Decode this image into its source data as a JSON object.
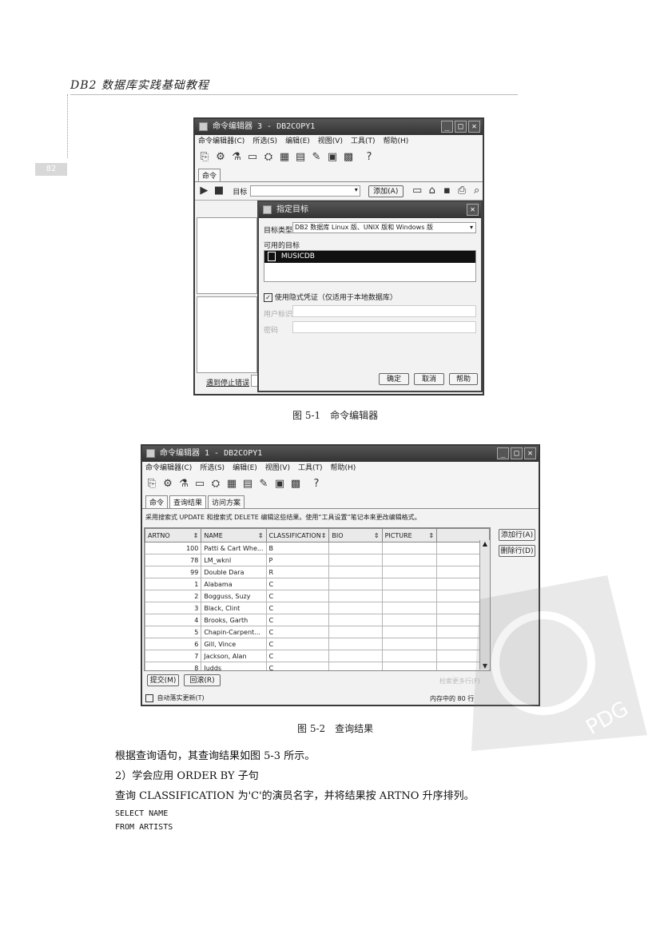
{
  "page": {
    "header": "DB2 数据库实践基础教程",
    "page_number": "82"
  },
  "fig1": {
    "window_title": "命令编辑器 3 - DB2COPY1",
    "menu": [
      "命令编辑器(C)",
      "所选(S)",
      "编辑(E)",
      "视图(V)",
      "工具(T)",
      "帮助(H)"
    ],
    "tab": "命令",
    "target_label": "目标",
    "add_button": "添加(A)",
    "left_button": "遇到停止错误",
    "dialog": {
      "title": "指定目标",
      "target_type_label": "目标类型",
      "target_type_value": "DB2 数据库 Linux 版、UNIX 版和 Windows 版",
      "available_label": "可用的目标",
      "selected_target": "MUSICDB",
      "implicit_check_label": "使用隐式凭证（仅适用于本地数据库）",
      "user_label": "用户标识",
      "password_label": "密码",
      "ok": "确定",
      "cancel": "取消",
      "help": "帮助"
    },
    "caption": "图 5-1　命令编辑器"
  },
  "fig2": {
    "window_title": "命令编辑器 1 - DB2COPY1",
    "menu": [
      "命令编辑器(C)",
      "所选(S)",
      "编辑(E)",
      "视图(V)",
      "工具(T)",
      "帮助(H)"
    ],
    "tabs": [
      "命令",
      "查询结果",
      "访问方案"
    ],
    "info": "采用搜索式 UPDATE 和搜索式 DELETE 编辑这些结果。使用“工具设置”笔记本来更改编辑格式。",
    "columns": [
      "ARTNO",
      "NAME",
      "CLASSIFICATION",
      "BIO",
      "PICTURE"
    ],
    "rows": [
      [
        "100",
        "Patti & Cart Whe...",
        "B",
        "",
        ""
      ],
      [
        "78",
        "LM_wknl",
        "P",
        "",
        ""
      ],
      [
        "99",
        "Double Dara",
        "R",
        "",
        ""
      ],
      [
        "1",
        "Alabama",
        "C",
        "",
        ""
      ],
      [
        "2",
        "Bogguss, Suzy",
        "C",
        "",
        ""
      ],
      [
        "3",
        "Black, Clint",
        "C",
        "",
        ""
      ],
      [
        "4",
        "Brooks, Garth",
        "C",
        "",
        ""
      ],
      [
        "5",
        "Chapin-Carpent...",
        "C",
        "",
        ""
      ],
      [
        "6",
        "Gill, Vince",
        "C",
        "",
        ""
      ],
      [
        "7",
        "Jackson, Alan",
        "C",
        "",
        ""
      ],
      [
        "8",
        "Judds",
        "C",
        "",
        ""
      ]
    ],
    "add_row": "添加行(A)",
    "delete_row": "删除行(D)",
    "commit": "提交(M)",
    "rollback": "回滚(R)",
    "auto_commit": "自动落实更新(T)",
    "faded_label": "检索更多行(F)",
    "status": "内存中的 80 行",
    "caption": "图 5-2　查询结果"
  },
  "body": {
    "line1": "根据查询语句，其查询结果如图 5-3 所示。",
    "line2": "2）学会应用 ORDER BY 子句",
    "line3": "查询 CLASSIFICATION 为'C'的演员名字，并将结果按 ARTNO 升序排列。",
    "code1": "SELECT NAME",
    "code2": "FROM ARTISTS"
  },
  "watermark": {
    "text": "PDG"
  }
}
